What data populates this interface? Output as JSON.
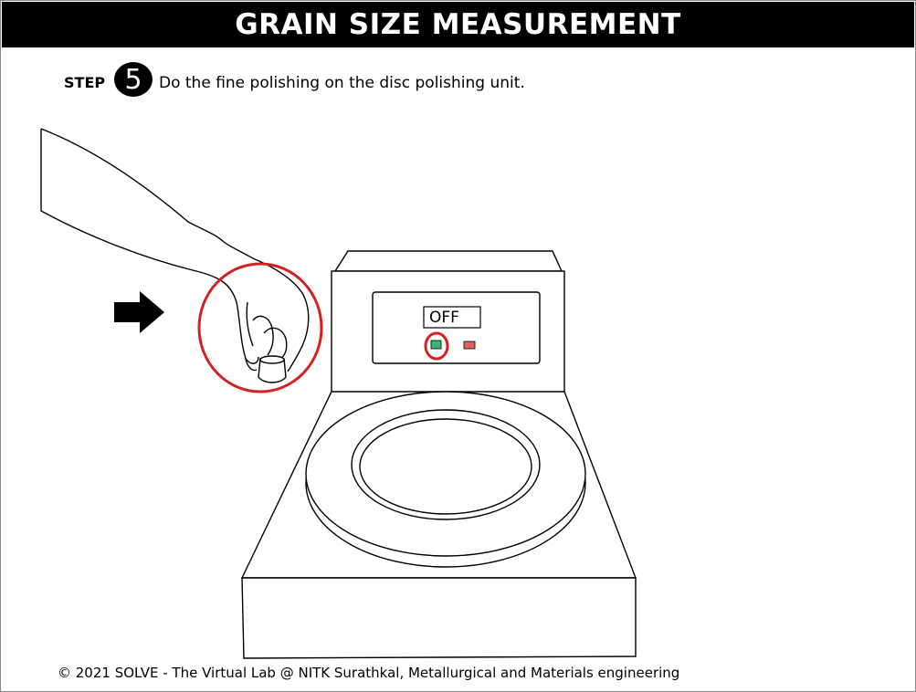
{
  "header": {
    "title": "GRAIN SIZE MEASUREMENT"
  },
  "step": {
    "label": "STEP",
    "number": "5",
    "instruction": "Do the fine polishing on the disc polishing unit."
  },
  "machine": {
    "display_text": "OFF",
    "on_button_color": "#3cb371",
    "off_button_color": "#e06060",
    "highlight_color": "#d42020"
  },
  "icons": {
    "pointer": "arrow-right-icon"
  },
  "footer": {
    "copyright": "© 2021 SOLVE - The Virtual Lab @ NITK Surathkal, Metallurgical and Materials engineering"
  }
}
